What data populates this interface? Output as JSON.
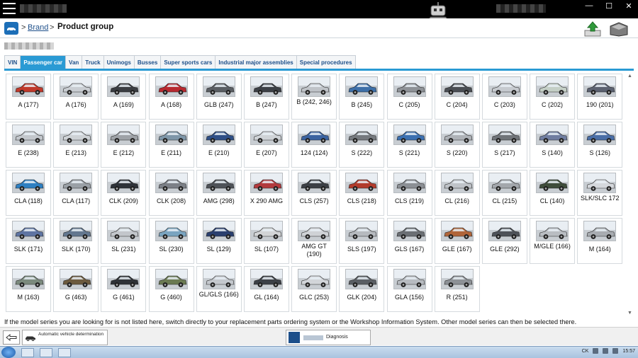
{
  "window": {
    "min_label": "—",
    "max_label": "☐",
    "close_label": "✕"
  },
  "breadcrumb": {
    "sep1": ">",
    "brand_link": "Brand",
    "sep2": ">",
    "current": "Product group"
  },
  "tabs": [
    {
      "label": "VIN",
      "active": false
    },
    {
      "label": "Passenger car",
      "active": true
    },
    {
      "label": "Van",
      "active": false
    },
    {
      "label": "Truck",
      "active": false
    },
    {
      "label": "Unimogs",
      "active": false
    },
    {
      "label": "Busses",
      "active": false
    },
    {
      "label": "Super sports cars",
      "active": false
    },
    {
      "label": "Industrial major assemblies",
      "active": false
    },
    {
      "label": "Special procedures",
      "active": false
    }
  ],
  "models": [
    {
      "label": "A (177)",
      "color": "#c0392b"
    },
    {
      "label": "A (176)",
      "color": "#c9cdd2"
    },
    {
      "label": "A (169)",
      "color": "#3a3d42"
    },
    {
      "label": "A (168)",
      "color": "#b7282f"
    },
    {
      "label": "GLB (247)",
      "color": "#5a5e63"
    },
    {
      "label": "B (247)",
      "color": "#3c4046"
    },
    {
      "label": "B (242, 246)",
      "color": "#bfc3c8"
    },
    {
      "label": "B (245)",
      "color": "#3d6fa8"
    },
    {
      "label": "C (205)",
      "color": "#8e9297"
    },
    {
      "label": "C (204)",
      "color": "#4a4e54"
    },
    {
      "label": "C (203)",
      "color": "#c6cacf"
    },
    {
      "label": "C (202)",
      "color": "#c4cfc6"
    },
    {
      "label": "190 (201)",
      "color": "#5b6170"
    },
    {
      "label": "E (238)",
      "color": "#c3c7cc"
    },
    {
      "label": "E (213)",
      "color": "#ced2d6"
    },
    {
      "label": "E (212)",
      "color": "#9ea2a7"
    },
    {
      "label": "E (211)",
      "color": "#7e96a8"
    },
    {
      "label": "E (210)",
      "color": "#2f4f86"
    },
    {
      "label": "E (207)",
      "color": "#cfd3d7"
    },
    {
      "label": "124 (124)",
      "color": "#3b63a0"
    },
    {
      "label": "S (222)",
      "color": "#75797e"
    },
    {
      "label": "S (221)",
      "color": "#3c70b0"
    },
    {
      "label": "S (220)",
      "color": "#aeb2b7"
    },
    {
      "label": "S (217)",
      "color": "#707479"
    },
    {
      "label": "S (140)",
      "color": "#6f7da0"
    },
    {
      "label": "S (126)",
      "color": "#4a6ea6"
    },
    {
      "label": "CLA (118)",
      "color": "#2e7fc1"
    },
    {
      "label": "CLA (117)",
      "color": "#9aa0a6"
    },
    {
      "label": "CLK (209)",
      "color": "#2e3238"
    },
    {
      "label": "CLK (208)",
      "color": "#7c8087"
    },
    {
      "label": "AMG (298)",
      "color": "#4e5258"
    },
    {
      "label": "X 290 AMG",
      "color": "#b23a3d"
    },
    {
      "label": "CLS (257)",
      "color": "#3b3f45"
    },
    {
      "label": "CLS (218)",
      "color": "#b23b2c"
    },
    {
      "label": "CLS (219)",
      "color": "#8c9095"
    },
    {
      "label": "CL (216)",
      "color": "#bfc3c8"
    },
    {
      "label": "CL (215)",
      "color": "#a3a7ac"
    },
    {
      "label": "CL (140)",
      "color": "#3e4c3a"
    },
    {
      "label": "SLK/SLC 172",
      "color": "#d5d8dc"
    },
    {
      "label": "SLK (171)",
      "color": "#5e74a2"
    },
    {
      "label": "SLK (170)",
      "color": "#63778f"
    },
    {
      "label": "SL (231)",
      "color": "#c2c6cb"
    },
    {
      "label": "SL (230)",
      "color": "#7aa4c0"
    },
    {
      "label": "SL (129)",
      "color": "#2a3f6e"
    },
    {
      "label": "SL (107)",
      "color": "#d2d4d6"
    },
    {
      "label": "AMG GT (190)",
      "color": "#cfd2d6"
    },
    {
      "label": "SLS (197)",
      "color": "#b6babf"
    },
    {
      "label": "GLS (167)",
      "color": "#6b6f74"
    },
    {
      "label": "GLE (167)",
      "color": "#b0653a"
    },
    {
      "label": "GLE (292)",
      "color": "#4e5258"
    },
    {
      "label": "M/GLE (166)",
      "color": "#b9bdc2"
    },
    {
      "label": "M (164)",
      "color": "#a8acb1"
    },
    {
      "label": "M (163)",
      "color": "#7b8a7d"
    },
    {
      "label": "G (463)",
      "color": "#6c5a3e"
    },
    {
      "label": "G (461)",
      "color": "#2f3236"
    },
    {
      "label": "G (460)",
      "color": "#6b7a52"
    },
    {
      "label": "GL/GLS (166)",
      "color": "#c4c8cd"
    },
    {
      "label": "GL (164)",
      "color": "#3c4046"
    },
    {
      "label": "GLC (253)",
      "color": "#d2d5d9"
    },
    {
      "label": "GLK (204)",
      "color": "#5a5e63"
    },
    {
      "label": "GLA (156)",
      "color": "#b7bbc0"
    },
    {
      "label": "R (251)",
      "color": "#8d9196"
    }
  ],
  "info_text": "If the model series you are looking for is not listed here, switch directly to your replacement parts ordering system or the Workshop Information System. Other model series can then be selected there.",
  "bottom": {
    "auto_label": "Automatic vehicle determination",
    "diagnosis_label": "Diagnosis"
  },
  "taskbar": {
    "lang": "CK",
    "time": "15:57"
  },
  "colors": {
    "accent": "#2a9ad4",
    "link": "#1d4f8a",
    "home_button": "#1d6fb8"
  }
}
